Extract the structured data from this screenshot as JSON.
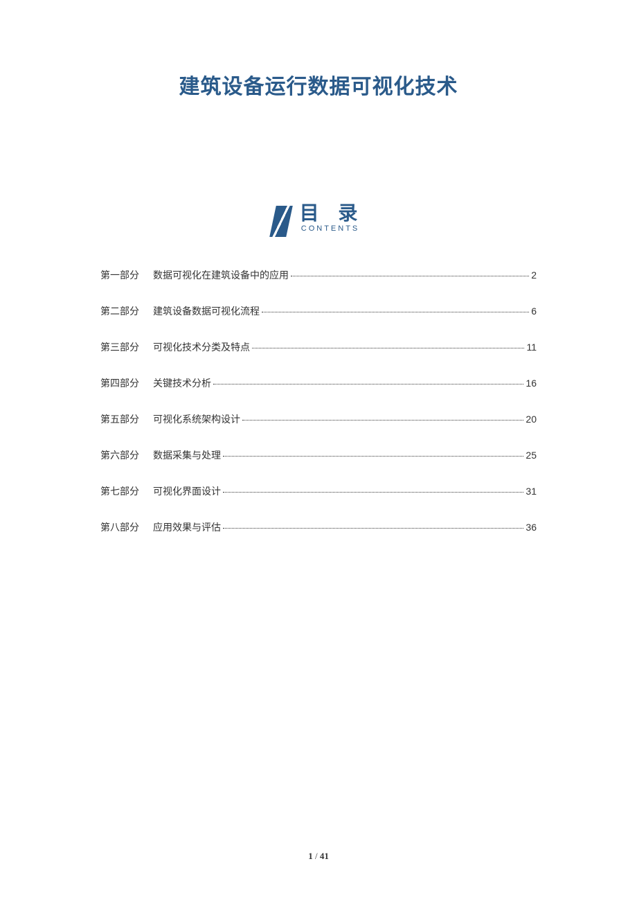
{
  "title": "建筑设备运行数据可视化技术",
  "toc": {
    "heading": "目 录",
    "subheading": "CONTENTS",
    "items": [
      {
        "part": "第一部分",
        "text": "数据可视化在建筑设备中的应用",
        "page": "2"
      },
      {
        "part": "第二部分",
        "text": "建筑设备数据可视化流程",
        "page": "6"
      },
      {
        "part": "第三部分",
        "text": "可视化技术分类及特点",
        "page": "11"
      },
      {
        "part": "第四部分",
        "text": "关键技术分析",
        "page": "16"
      },
      {
        "part": "第五部分",
        "text": "可视化系统架构设计",
        "page": "20"
      },
      {
        "part": "第六部分",
        "text": "数据采集与处理",
        "page": "25"
      },
      {
        "part": "第七部分",
        "text": "可视化界面设计",
        "page": "31"
      },
      {
        "part": "第八部分",
        "text": "应用效果与评估",
        "page": "36"
      }
    ]
  },
  "footer": {
    "current": "1",
    "sep": " / ",
    "total": "41"
  }
}
